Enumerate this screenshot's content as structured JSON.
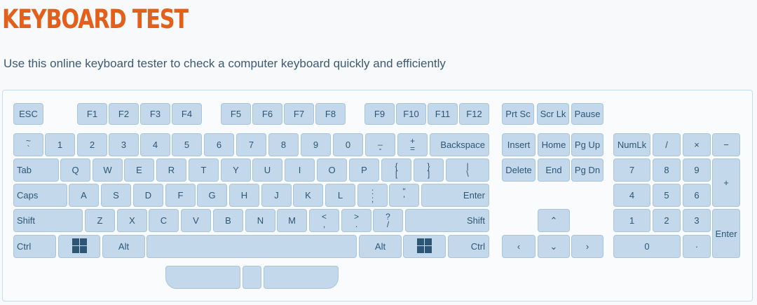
{
  "header": {
    "title": "KEYBOARD TEST",
    "subtitle": "Use this online keyboard tester to check a computer keyboard quickly and efficiently"
  },
  "keyboard": {
    "fn_row": {
      "esc": "ESC",
      "f1": "F1",
      "f2": "F2",
      "f3": "F3",
      "f4": "F4",
      "f5": "F5",
      "f6": "F6",
      "f7": "F7",
      "f8": "F8",
      "f9": "F9",
      "f10": "F10",
      "f11": "F11",
      "f12": "F12",
      "prtsc": "Prt Sc",
      "scrlk": "Scr Lk",
      "pause": "Pause"
    },
    "number_row": {
      "tilde_top": "~",
      "tilde_bottom": "`",
      "n1": "1",
      "n2": "2",
      "n3": "3",
      "n4": "4",
      "n5": "5",
      "n6": "6",
      "n7": "7",
      "n8": "8",
      "n9": "9",
      "n0": "0",
      "minus_top": "_",
      "minus_bottom": "-",
      "plus_top": "+",
      "plus_bottom": "=",
      "backspace": "Backspace"
    },
    "top_row": {
      "tab": "Tab",
      "q": "Q",
      "w": "W",
      "e": "E",
      "r": "R",
      "t": "T",
      "y": "Y",
      "u": "U",
      "i": "I",
      "o": "O",
      "p": "P",
      "lbracket_top": "{",
      "lbracket_bottom": "[",
      "rbracket_top": "}",
      "rbracket_bottom": "]",
      "backslash_top": "|",
      "backslash_bottom": "\\"
    },
    "home_row": {
      "caps": "Caps",
      "a": "A",
      "s": "S",
      "d": "D",
      "f": "F",
      "g": "G",
      "h": "H",
      "j": "J",
      "k": "K",
      "l": "L",
      "semicolon_top": ":",
      "semicolon_bottom": ";",
      "quote_top": "\"",
      "quote_bottom": "'",
      "enter": "Enter"
    },
    "bottom_row": {
      "lshift": "Shift",
      "z": "Z",
      "x": "X",
      "c": "C",
      "v": "V",
      "b": "B",
      "n": "N",
      "m": "M",
      "comma_top": "<",
      "comma_bottom": ",",
      "period_top": ">",
      "period_bottom": ".",
      "slash_top": "?",
      "slash_bottom": "/",
      "rshift": "Shift"
    },
    "space_row": {
      "lctrl": "Ctrl",
      "lalt": "Alt",
      "ralt": "Alt",
      "rctrl": "Ctrl"
    },
    "nav": {
      "insert": "Insert",
      "home": "Home",
      "pgup": "Pg Up",
      "delete": "Delete",
      "end": "End",
      "pgdn": "Pg Dn",
      "up": "⌃",
      "left": "‹",
      "down": "⌄",
      "right": "›"
    },
    "numpad": {
      "numlk": "NumLk",
      "divide": "/",
      "multiply": "×",
      "subtract": "−",
      "n7": "7",
      "n8": "8",
      "n9": "9",
      "add": "+",
      "n4": "4",
      "n5": "5",
      "n6": "6",
      "n1": "1",
      "n2": "2",
      "n3": "3",
      "enter": "Enter",
      "n0": "0",
      "decimal": "·"
    }
  },
  "icons": {
    "windows": "windows-icon"
  }
}
